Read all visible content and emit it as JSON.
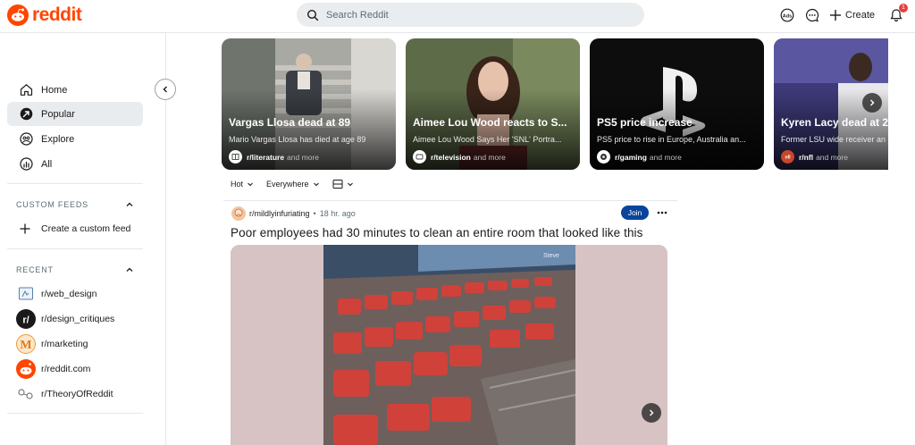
{
  "header": {
    "logo_text": "reddit",
    "search_placeholder": "Search Reddit",
    "create_label": "Create",
    "notification_count": "1",
    "advertise_label": "Ads"
  },
  "sidebar": {
    "nav": [
      {
        "label": "Home",
        "icon": "home-icon"
      },
      {
        "label": "Popular",
        "icon": "popular-icon",
        "active": true
      },
      {
        "label": "Explore",
        "icon": "explore-icon"
      },
      {
        "label": "All",
        "icon": "all-icon"
      }
    ],
    "custom_feeds_title": "CUSTOM FEEDS",
    "create_custom_feed": "Create a custom feed",
    "recent_title": "RECENT",
    "recent": [
      {
        "name": "r/web_design"
      },
      {
        "name": "r/design_critiques"
      },
      {
        "name": "r/marketing"
      },
      {
        "name": "r/reddit.com"
      },
      {
        "name": "r/TheoryOfReddit"
      }
    ]
  },
  "trending": [
    {
      "title": "Vargas Llosa dead at 89",
      "subtitle": "Mario Vargas Llosa has died at age 89",
      "subreddit": "r/literature",
      "more": "and more"
    },
    {
      "title": "Aimee Lou Wood reacts to S...",
      "subtitle": "Aimee Lou Wood Says Her 'SNL' Portra...",
      "subreddit": "r/television",
      "more": "and more"
    },
    {
      "title": "PS5 price increase",
      "subtitle": "PS5 price to rise in Europe, Australia an...",
      "subreddit": "r/gaming",
      "more": "and more"
    },
    {
      "title": "Kyren Lacy dead at 2",
      "subtitle": "Former LSU wide receiver an",
      "subreddit": "r/nfl",
      "more": "and more"
    }
  ],
  "sort": {
    "order": "Hot",
    "location": "Everywhere"
  },
  "post": {
    "subreddit": "r/mildlyinfuriating",
    "time": "18 hr. ago",
    "join_label": "Join",
    "title": "Poor employees had 30 minutes to clean an entire room that looked like this",
    "screen_text": "Steve"
  },
  "colors": {
    "brand": "#ff4500",
    "join": "#0a449b",
    "badge": "#e8403e"
  }
}
